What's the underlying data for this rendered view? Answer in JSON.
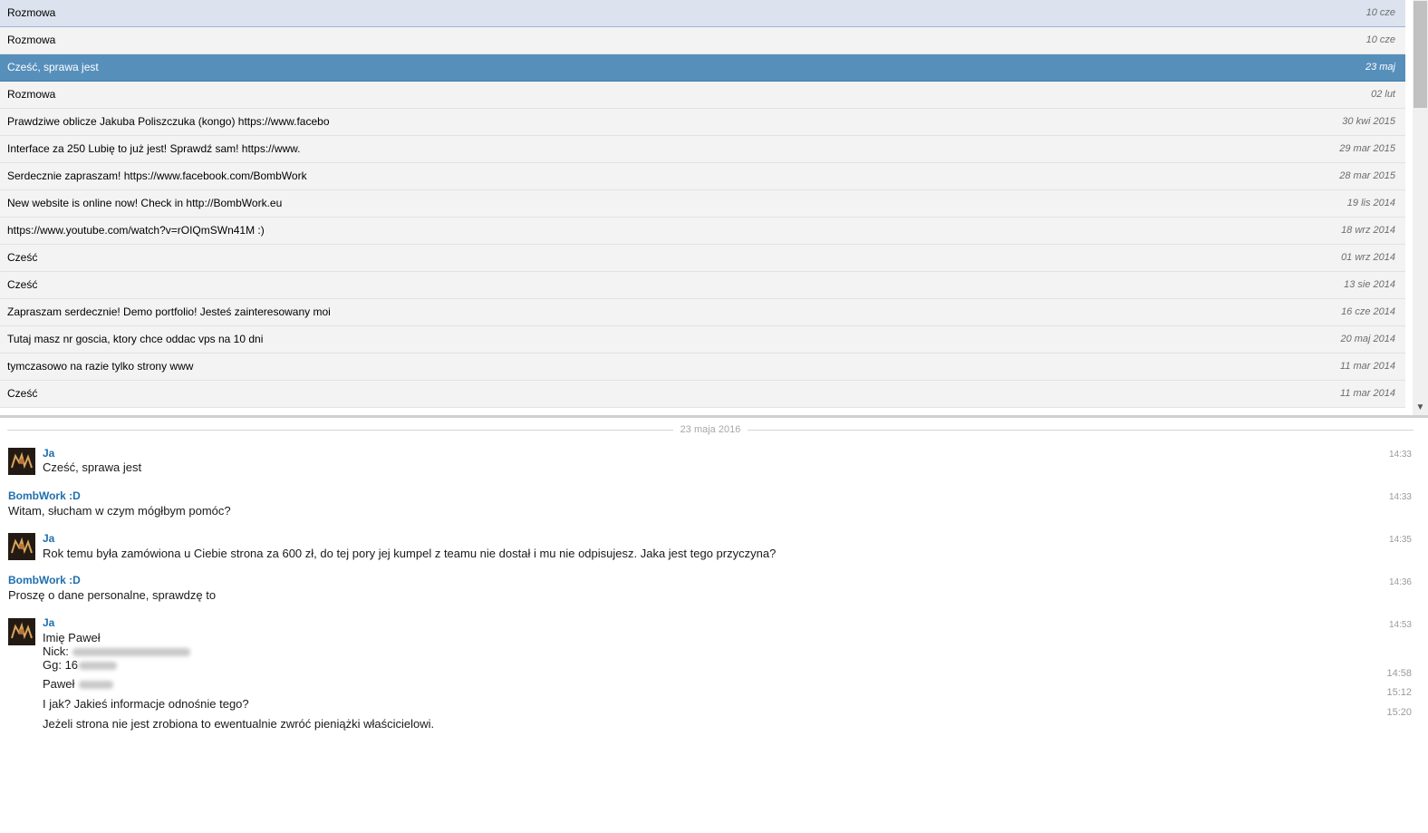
{
  "conversations": [
    {
      "subject": "Rozmowa",
      "date": "10 cze"
    },
    {
      "subject": "Rozmowa",
      "date": "10 cze"
    },
    {
      "subject": "Cześć, sprawa jest",
      "date": "23 maj"
    },
    {
      "subject": "Rozmowa",
      "date": "02 lut"
    },
    {
      "subject": "Prawdziwe oblicze Jakuba Poliszczuka (kongo) https://www.facebo",
      "date": "30 kwi 2015"
    },
    {
      "subject": "Interface za 250 Lubię to już jest! Sprawdź sam! https://www.",
      "date": "29 mar 2015"
    },
    {
      "subject": "Serdecznie zapraszam! https://www.facebook.com/BombWork",
      "date": "28 mar 2015"
    },
    {
      "subject": "New website is online now! Check in http://BombWork.eu",
      "date": "19 lis 2014"
    },
    {
      "subject": "https://www.youtube.com/watch?v=rOIQmSWn41M :)",
      "date": "18 wrz 2014"
    },
    {
      "subject": "Cześć",
      "date": "01 wrz 2014"
    },
    {
      "subject": "Cześć",
      "date": "13 sie 2014"
    },
    {
      "subject": "Zapraszam serdecznie! Demo portfolio! Jesteś zainteresowany moi",
      "date": "16 cze 2014"
    },
    {
      "subject": "Tutaj masz nr goscia, ktory chce oddac vps na 10 dni",
      "date": "20 maj 2014"
    },
    {
      "subject": "tymczasowo na razie tylko strony www",
      "date": "11 mar 2014"
    },
    {
      "subject": "Cześć",
      "date": "11 mar 2014"
    }
  ],
  "selected_index": 2,
  "colors": {
    "accent": "#578fbb",
    "sender": "#1f6fae",
    "top_row": "#dce3ef"
  },
  "messages": {
    "day_separator": "23 maja 2016",
    "m1": {
      "sender": "Ja",
      "text": "Cześć, sprawa jest",
      "time": "14:33"
    },
    "m2": {
      "sender": "BombWork :D",
      "text": "Witam, słucham w czym mógłbym pomóc?",
      "time": "14:33"
    },
    "m3": {
      "sender": "Ja",
      "text": "Rok temu była zamówiona u Ciebie strona za 600 zł, do tej pory jej kumpel z teamu nie dostał i mu nie odpisujesz. Jaka jest tego przyczyna?",
      "time": "14:35"
    },
    "m4": {
      "sender": "BombWork :D",
      "text": "Proszę o dane personalne, sprawdzę to",
      "time": "14:36"
    },
    "m5": {
      "sender": "Ja",
      "line1": "Imię Paweł",
      "line2": "Nick:",
      "line3": "Gg: 16",
      "time": "14:53"
    },
    "m6": {
      "text": "Paweł",
      "time": "14:58"
    },
    "m7": {
      "text": "I jak? Jakieś informacje odnośnie tego?",
      "time": "15:12"
    },
    "m8": {
      "text": "Jeżeli strona nie jest zrobiona to ewentualnie zwróć pieniążki właścicielowi.",
      "time": "15:20"
    }
  }
}
